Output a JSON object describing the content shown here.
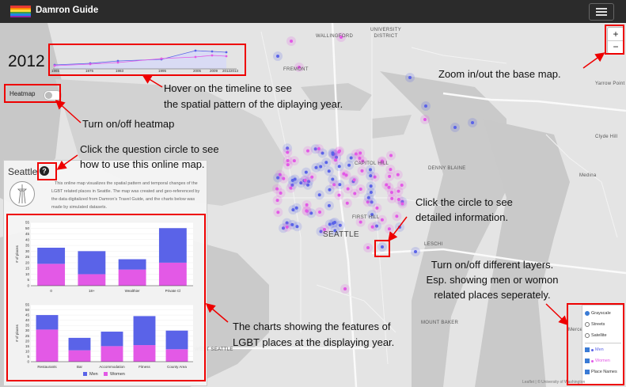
{
  "navbar": {
    "brand": "Damron Guide",
    "logo_colors": [
      "#e53935",
      "#fb8c00",
      "#fdd835",
      "#43a047",
      "#1e88e5",
      "#8e24aa"
    ],
    "menu_icon": "hamburger-menu-icon"
  },
  "map_labels": [
    "WALLINGFORD",
    "UNIVERSITY\nDISTRICT",
    "FREMONT",
    "CAPITOL HILL",
    "DENNY BLAINE",
    "FIRST HILL",
    "SEATTLE",
    "LESCHI",
    "MOUNT BAKER",
    "WEST SEATTLE",
    "Yarrow Point",
    "Clyde Hill",
    "Medina",
    "Mercer Island"
  ],
  "timeline": {
    "year": "2012",
    "ticks": [
      "1965",
      "1975",
      "1983",
      "1995",
      "2005",
      "2009",
      "20122013"
    ],
    "colors": {
      "men": "#5a63e8",
      "women": "#e359e6"
    }
  },
  "heatmap": {
    "label": "Heatmap",
    "enabled": false
  },
  "zoom": {
    "in_label": "+",
    "out_label": "−"
  },
  "panel": {
    "title": "Seattle",
    "help_icon": "?",
    "description": "This online map visualizes the spatial pattern and temporal changes of the LGBT related places in Seattle. The map was created and geo-referenced by the data digitalized from Damron's Travel Guide, and the charts below was made by simulated datasets."
  },
  "chart_data": [
    {
      "type": "bar",
      "stacked": true,
      "categories": [
        "0",
        "18+",
        "Wealthier",
        "Private Cl"
      ],
      "series": [
        {
          "name": "Men",
          "values": [
            14,
            20,
            9,
            30
          ]
        },
        {
          "name": "Women",
          "values": [
            19,
            10,
            14,
            20
          ]
        }
      ],
      "ylabel": "# of places",
      "ylim": [
        0,
        55
      ],
      "yticks": [
        "0",
        "5",
        "10",
        "15",
        "20",
        "25",
        "30",
        "35",
        "40",
        "45",
        "50",
        "55"
      ],
      "grid": true
    },
    {
      "type": "bar",
      "stacked": true,
      "categories": [
        "Restaurants",
        "Bar",
        "Accommodation",
        "Fitness",
        "County Area"
      ],
      "series": [
        {
          "name": "Men",
          "values": [
            14,
            12,
            14,
            28,
            18
          ]
        },
        {
          "name": "Women",
          "values": [
            31,
            11,
            15,
            16,
            12
          ]
        }
      ],
      "ylabel": "# of places",
      "ylim": [
        0,
        55
      ],
      "yticks": [
        "0",
        "5",
        "10",
        "15",
        "20",
        "25",
        "30",
        "35",
        "40",
        "45",
        "50",
        "55"
      ],
      "grid": true,
      "legend": [
        "Men",
        "Women"
      ],
      "legend_position": "bottom"
    }
  ],
  "layers": {
    "basemaps": [
      {
        "label": "Grayscale",
        "selected": true
      },
      {
        "label": "Streets",
        "selected": false
      },
      {
        "label": "Satellite",
        "selected": false
      }
    ],
    "overlays": [
      {
        "label": "Men",
        "checked": true,
        "color": "#5a63e8"
      },
      {
        "label": "Women",
        "checked": true,
        "color": "#e359e6"
      },
      {
        "label": "Place Names",
        "checked": true
      }
    ]
  },
  "attribution": "Leaflet | © University of Washington",
  "annotations": {
    "zoom": "Zoom in/out the base map.",
    "timeline": "Hover on the timeline to see\nthe spatial pattern of the diplaying year.",
    "heatmap": "Turn on/off heatmap",
    "help": "Click the question circle to see\nhow to use this online map.",
    "circle": "Click the circle to see\ndetailed information.",
    "layers": "Turn on/off different layers.\nEsp. showing men or womon\nrelated places seperately.",
    "charts": "The charts showing the features of\nLGBT places at the displaying year."
  }
}
